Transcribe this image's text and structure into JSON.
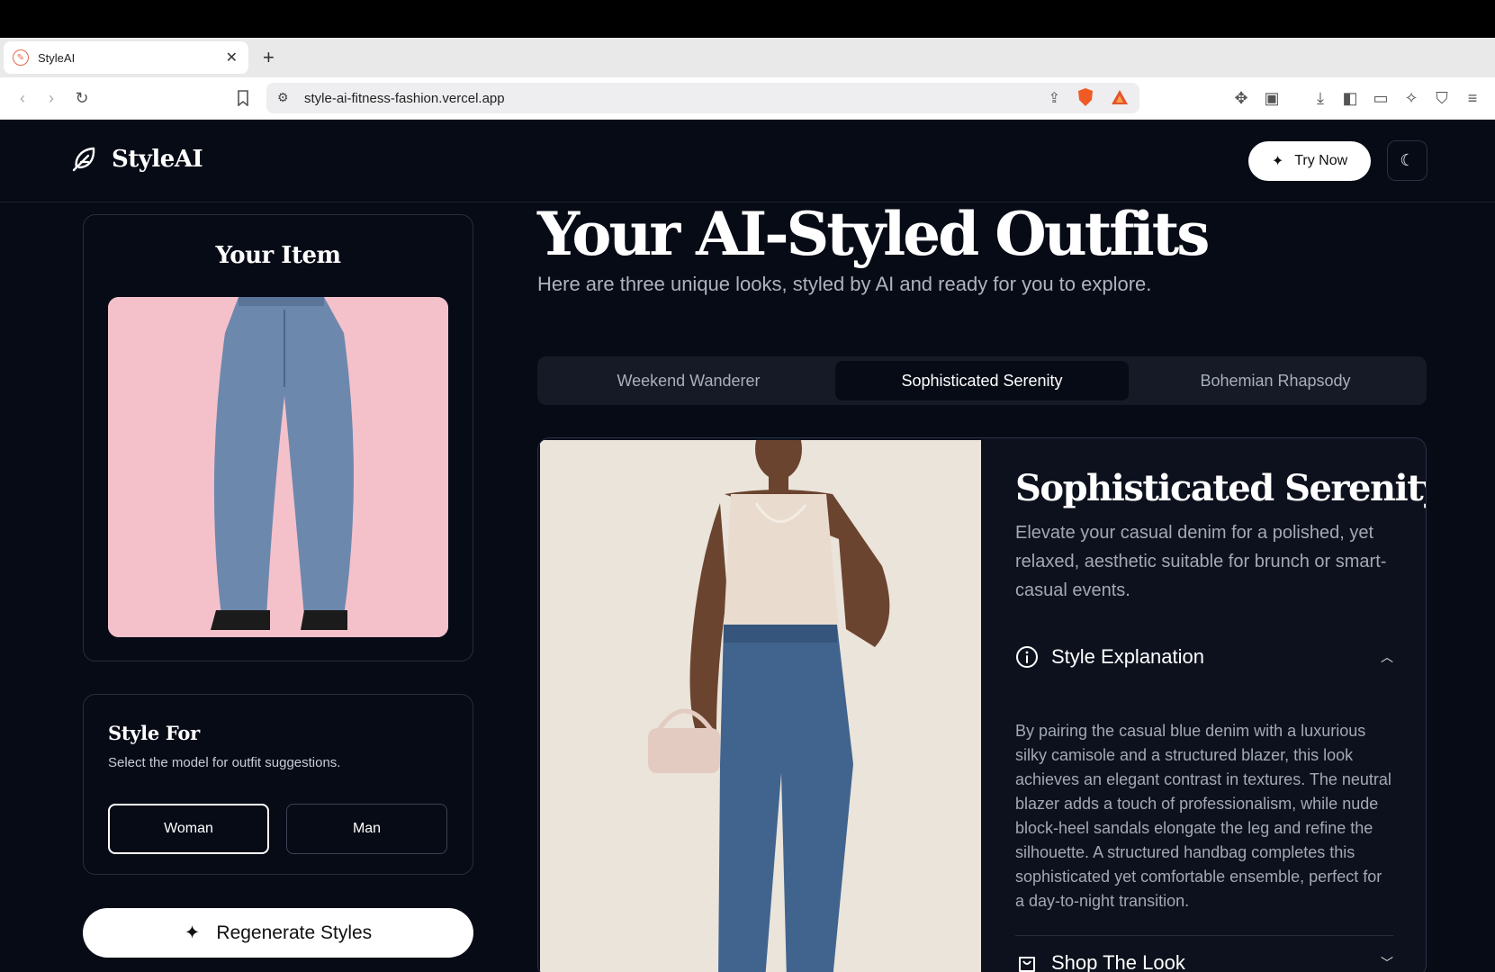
{
  "browser": {
    "tab_title": "StyleAI",
    "url": "style-ai-fitness-fashion.vercel.app"
  },
  "header": {
    "brand": "StyleAI",
    "try_now": "Try Now"
  },
  "sidebar": {
    "item_title": "Your Item",
    "style_for_title": "Style For",
    "style_for_hint": "Select the model for outfit suggestions.",
    "options": [
      "Woman",
      "Man"
    ],
    "selected": "Woman",
    "regenerate": "Regenerate Styles"
  },
  "main": {
    "title": "Your AI-Styled Outfits",
    "subtitle": "Here are three unique looks, styled by AI and ready for you to explore.",
    "tabs": [
      "Weekend Wanderer",
      "Sophisticated Serenity",
      "Bohemian Rhapsody"
    ],
    "active_tab": "Sophisticated Serenity",
    "outfit": {
      "name": "Sophisticated Serenity",
      "description": "Elevate your casual denim for a polished, yet relaxed, aesthetic suitable for brunch or smart-casual events.",
      "explanation_heading": "Style Explanation",
      "explanation": "By pairing the casual blue denim with a luxurious silky camisole and a structured blazer, this look achieves an elegant contrast in textures. The neutral blazer adds a touch of professionalism, while nude block-heel sandals elongate the leg and refine the silhouette. A structured handbag completes this sophisticated yet comfortable ensemble, perfect for a day-to-night transition.",
      "shop_heading": "Shop The Look"
    }
  }
}
